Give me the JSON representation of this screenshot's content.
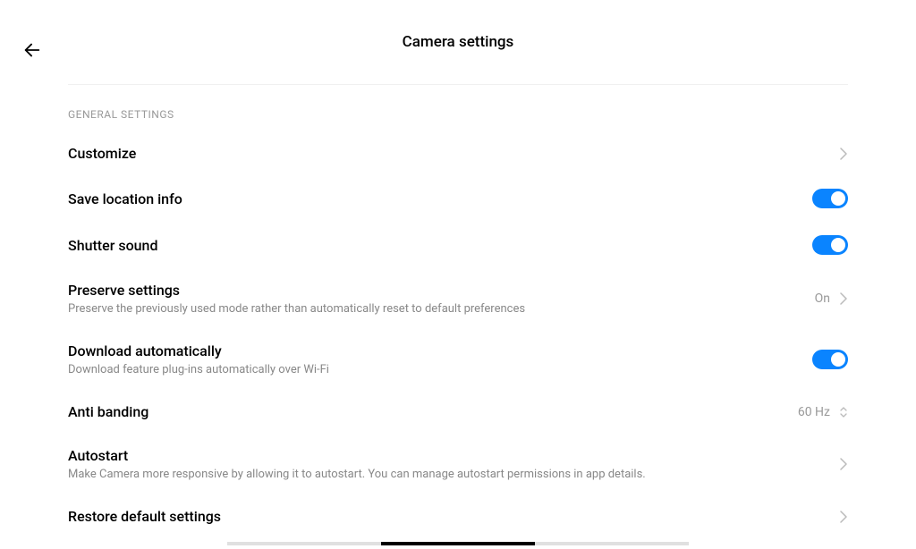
{
  "header": {
    "title": "Camera settings"
  },
  "section_label": "GENERAL SETTINGS",
  "rows": {
    "customize": {
      "title": "Customize"
    },
    "save_location": {
      "title": "Save location info",
      "toggle": true
    },
    "shutter_sound": {
      "title": "Shutter sound",
      "toggle": true
    },
    "preserve": {
      "title": "Preserve settings",
      "subtitle": "Preserve the previously used mode rather than automatically reset to default preferences",
      "value": "On"
    },
    "download_auto": {
      "title": "Download automatically",
      "subtitle": "Download feature plug-ins automatically over Wi-Fi",
      "toggle": true
    },
    "anti_banding": {
      "title": "Anti banding",
      "value": "60 Hz"
    },
    "autostart": {
      "title": "Autostart",
      "subtitle": "Make Camera more responsive by allowing it to autostart. You can manage autostart permissions in app details."
    },
    "restore": {
      "title": "Restore default settings"
    }
  }
}
